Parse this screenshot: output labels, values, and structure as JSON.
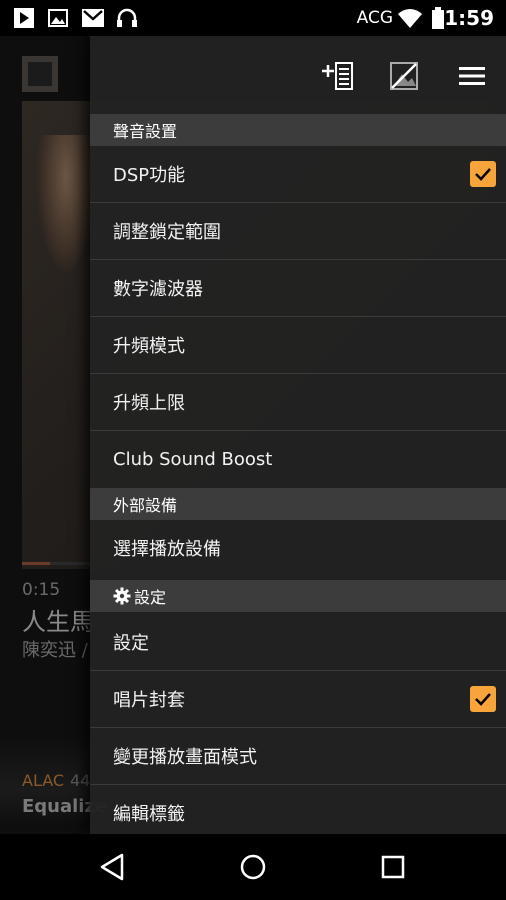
{
  "status_bar": {
    "carrier": "ACG",
    "time": "1:59",
    "icons": [
      "play-store-icon",
      "image-icon",
      "gmail-icon",
      "headphones-icon",
      "wifi-icon",
      "battery-icon"
    ]
  },
  "player": {
    "time": "0:15",
    "song": "人生馬",
    "artist": "陳奕迅 /",
    "format": "ALAC",
    "sample": "44",
    "equalizer": "Equalize",
    "progress": 0.06
  },
  "drawer": {
    "toolbar_icons": [
      "add-to-playlist-icon",
      "no-cover-icon",
      "menu-icon"
    ],
    "sections": [
      {
        "title": "聲音設置",
        "items": [
          {
            "label": "DSP功能",
            "checked": true
          },
          {
            "label": "調整鎖定範圍",
            "checked": false
          },
          {
            "label": "數字濾波器",
            "checked": false
          },
          {
            "label": "升頻模式",
            "checked": false
          },
          {
            "label": "升頻上限",
            "checked": false
          },
          {
            "label": "Club Sound Boost",
            "checked": false
          }
        ]
      },
      {
        "title": "外部設備",
        "items": [
          {
            "label": "選擇播放設備",
            "checked": false
          }
        ]
      },
      {
        "title": "設定",
        "items": [
          {
            "label": "設定",
            "checked": false
          },
          {
            "label": "唱片封套",
            "checked": true
          },
          {
            "label": "變更播放畫面模式",
            "checked": false
          },
          {
            "label": "編輯標籤",
            "checked": false
          }
        ]
      }
    ]
  },
  "colors": {
    "accent": "#f7a43b",
    "drawer_bg": "#222222",
    "section_bg": "#3c3c3c"
  }
}
